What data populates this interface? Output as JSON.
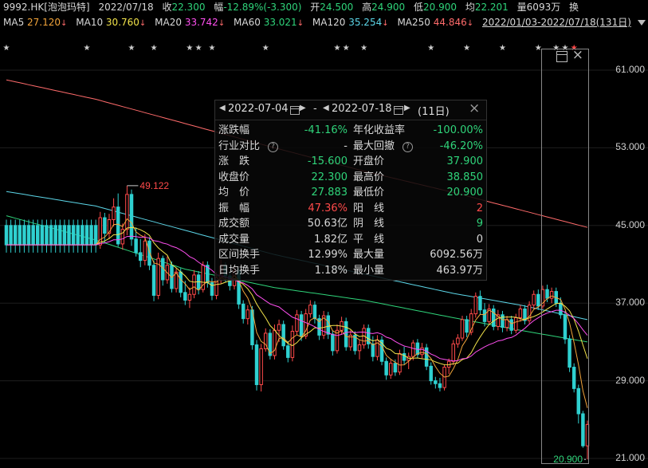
{
  "header": {
    "symbol": "9992.HK[泡泡玛特]",
    "date": "2022/07/18",
    "close_label": "收",
    "close_value": "22.300",
    "change_label": "幅",
    "change_value": "-12.89%(-3.300)",
    "open_label": "开",
    "open_value": "24.500",
    "high_label": "高",
    "high_value": "24.900",
    "low_label": "低",
    "low_value": "20.900",
    "avg_label": "均",
    "avg_value": "22.201",
    "volume_label": "量",
    "volume_value": "6093万",
    "turnover_label": "换"
  },
  "ma_bar": {
    "items": [
      {
        "label": "MA5",
        "value": "27.120",
        "color": "#f2a43a"
      },
      {
        "label": "MA10",
        "value": "30.760",
        "color": "#f2e34a"
      },
      {
        "label": "MA20",
        "value": "33.742",
        "color": "#ff4ff0"
      },
      {
        "label": "MA60",
        "value": "33.021",
        "color": "#2fd47a"
      },
      {
        "label": "MA120",
        "value": "35.254",
        "color": "#5cd6e8"
      },
      {
        "label": "MA250",
        "value": "44.846",
        "color": "#ff6b6b"
      }
    ],
    "arrow": "↓",
    "range": "2022/01/03-2022/07/18(131日)"
  },
  "panel": {
    "start_date": "2022-07-04",
    "sep": "-",
    "end_date": "2022-07-18",
    "days": "(11日)",
    "close_x": "×",
    "rows": [
      {
        "l1": "涨跌幅",
        "v1": "-41.16%",
        "c1": "#2fd47a",
        "l2": "年化收益率",
        "v2": "-100.00%",
        "c2": "#2fd47a"
      },
      {
        "l1": "行业对比",
        "v1": "-",
        "c1": "#d8d8d8",
        "l2": "最大回撤",
        "v2": "-46.20%",
        "c2": "#2fd47a"
      },
      {
        "l1": "涨　跌",
        "v1": "-15.600",
        "c1": "#2fd47a",
        "l2": "开盘价",
        "v2": "37.900",
        "c2": "#2fd47a"
      },
      {
        "l1": "收盘价",
        "v1": "22.300",
        "c1": "#2fd47a",
        "l2": "最高价",
        "v2": "38.850",
        "c2": "#2fd47a"
      },
      {
        "l1": "均　价",
        "v1": "27.883",
        "c1": "#2fd47a",
        "l2": "最低价",
        "v2": "20.900",
        "c2": "#2fd47a"
      },
      {
        "l1": "振　幅",
        "v1": "47.36%",
        "c1": "#ff4a4a",
        "l2": "阳　线",
        "v2": "2",
        "c2": "#ff4a4a"
      },
      {
        "l1": "成交额",
        "v1": "50.63亿",
        "c1": "#d8d8d8",
        "l2": "阴　线",
        "v2": "9",
        "c2": "#2fd47a"
      },
      {
        "l1": "成交量",
        "v1": "1.82亿",
        "c1": "#d8d8d8",
        "l2": "平　线",
        "v2": "0",
        "c2": "#d8d8d8"
      },
      {
        "l1": "区间换手",
        "v1": "12.99%",
        "c1": "#d8d8d8",
        "l2": "最大量",
        "v2": "6092.56万",
        "c2": "#d8d8d8"
      },
      {
        "l1": "日均换手",
        "v1": "1.18%",
        "c1": "#d8d8d8",
        "l2": "最小量",
        "v2": "463.97万",
        "c2": "#d8d8d8"
      }
    ]
  },
  "chart_data": {
    "type": "candlestick",
    "y_ticks": [
      "61.000",
      "53.000",
      "45.000",
      "37.000",
      "29.000",
      "21.000"
    ],
    "ylim": [
      21.0,
      61.0
    ],
    "annotations": {
      "high_label": "49.122",
      "low_label": "20.900"
    },
    "up_color": "#ff4a4a",
    "down_color": "#2fd0d0",
    "n": 131,
    "candles": [
      [
        45.0,
        45.6,
        42.2,
        43.0
      ],
      [
        43.0,
        46.4,
        42.6,
        45.8
      ],
      [
        45.8,
        46.3,
        43.2,
        44.2
      ],
      [
        44.2,
        46.2,
        43.6,
        45.6
      ],
      [
        45.6,
        47.8,
        44.9,
        46.9
      ],
      [
        46.9,
        48.3,
        42.8,
        43.1
      ],
      [
        43.1,
        45.2,
        42.5,
        44.6
      ],
      [
        44.6,
        49.1,
        44.0,
        48.2
      ],
      [
        48.2,
        48.7,
        42.9,
        43.6
      ],
      [
        43.6,
        44.8,
        41.8,
        42.2
      ],
      [
        42.2,
        43.6,
        40.7,
        41.4
      ],
      [
        41.4,
        44.1,
        40.9,
        43.4
      ],
      [
        43.4,
        43.8,
        40.4,
        40.9
      ],
      [
        40.9,
        41.4,
        37.2,
        37.8
      ],
      [
        37.8,
        42.2,
        37.4,
        41.6
      ],
      [
        41.6,
        41.9,
        38.8,
        39.4
      ],
      [
        39.4,
        41.8,
        39.0,
        40.9
      ],
      [
        40.9,
        41.3,
        38.1,
        38.5
      ],
      [
        38.5,
        40.6,
        38.1,
        40.2
      ],
      [
        40.2,
        40.6,
        37.6,
        38.1
      ],
      [
        38.1,
        39.3,
        36.8,
        37.3
      ],
      [
        37.3,
        38.6,
        36.5,
        37.9
      ],
      [
        37.9,
        40.4,
        37.5,
        39.9
      ],
      [
        39.9,
        40.3,
        37.9,
        38.4
      ],
      [
        38.4,
        41.3,
        38.1,
        40.9
      ],
      [
        40.9,
        41.3,
        38.6,
        39.1
      ],
      [
        39.1,
        39.6,
        37.3,
        37.8
      ],
      [
        37.8,
        40.2,
        37.4,
        39.6
      ],
      [
        39.6,
        41.5,
        39.0,
        40.8
      ],
      [
        40.8,
        41.2,
        39.2,
        39.8
      ],
      [
        39.8,
        40.2,
        38.3,
        38.8
      ],
      [
        38.8,
        40.7,
        38.4,
        40.3
      ],
      [
        40.3,
        40.6,
        36.4,
        36.9
      ],
      [
        36.9,
        37.3,
        34.9,
        35.4
      ],
      [
        35.4,
        36.8,
        34.8,
        36.3
      ],
      [
        36.3,
        36.7,
        32.2,
        32.7
      ],
      [
        32.7,
        33.2,
        28.0,
        28.6
      ],
      [
        28.6,
        32.8,
        27.9,
        32.3
      ],
      [
        32.3,
        34.4,
        32.0,
        33.9
      ],
      [
        33.9,
        34.3,
        31.2,
        31.6
      ],
      [
        31.6,
        34.8,
        31.2,
        34.2
      ],
      [
        34.2,
        35.3,
        33.0,
        34.8
      ],
      [
        34.8,
        35.2,
        32.2,
        32.6
      ],
      [
        32.6,
        33.1,
        30.9,
        31.4
      ],
      [
        31.4,
        34.7,
        31.0,
        34.1
      ],
      [
        34.1,
        36.3,
        33.7,
        35.8
      ],
      [
        35.8,
        36.2,
        33.1,
        33.6
      ],
      [
        33.6,
        36.4,
        33.3,
        35.9
      ],
      [
        35.9,
        37.3,
        35.5,
        36.8
      ],
      [
        36.8,
        37.2,
        34.9,
        35.4
      ],
      [
        35.4,
        35.8,
        33.2,
        33.7
      ],
      [
        33.7,
        36.2,
        33.3,
        35.7
      ],
      [
        35.7,
        36.1,
        33.3,
        33.8
      ],
      [
        33.8,
        34.2,
        31.6,
        32.1
      ],
      [
        32.1,
        34.8,
        31.8,
        34.2
      ],
      [
        34.2,
        35.6,
        33.8,
        35.1
      ],
      [
        35.1,
        35.5,
        32.1,
        32.5
      ],
      [
        32.5,
        34.2,
        32.1,
        33.7
      ],
      [
        33.7,
        34.1,
        31.7,
        32.1
      ],
      [
        32.1,
        33.2,
        31.2,
        32.7
      ],
      [
        32.7,
        34.8,
        32.3,
        34.4
      ],
      [
        34.4,
        34.8,
        32.3,
        32.8
      ],
      [
        32.8,
        33.6,
        31.0,
        31.5
      ],
      [
        31.5,
        33.7,
        31.1,
        33.2
      ],
      [
        33.2,
        33.6,
        30.6,
        31.0
      ],
      [
        31.0,
        31.4,
        29.1,
        29.6
      ],
      [
        29.6,
        31.2,
        29.2,
        30.8
      ],
      [
        30.8,
        31.2,
        29.5,
        29.9
      ],
      [
        29.9,
        32.2,
        29.6,
        31.8
      ],
      [
        31.8,
        32.5,
        30.7,
        31.1
      ],
      [
        31.1,
        31.9,
        30.2,
        31.5
      ],
      [
        31.5,
        33.2,
        31.1,
        32.9
      ],
      [
        32.9,
        33.3,
        31.3,
        31.7
      ],
      [
        31.7,
        32.9,
        31.3,
        32.4
      ],
      [
        32.4,
        32.8,
        30.1,
        30.5
      ],
      [
        30.5,
        30.9,
        28.6,
        29.0
      ],
      [
        29.0,
        29.4,
        28.2,
        28.7
      ],
      [
        28.7,
        29.3,
        27.9,
        28.3
      ],
      [
        28.3,
        30.7,
        28.0,
        30.4
      ],
      [
        30.4,
        31.3,
        29.7,
        31.0
      ],
      [
        31.0,
        33.2,
        30.6,
        32.8
      ],
      [
        32.8,
        33.8,
        32.4,
        33.4
      ],
      [
        33.4,
        35.7,
        33.1,
        35.3
      ],
      [
        35.3,
        35.7,
        33.5,
        34.0
      ],
      [
        34.0,
        36.4,
        33.7,
        35.9
      ],
      [
        35.9,
        38.1,
        35.5,
        37.7
      ],
      [
        37.7,
        38.3,
        35.8,
        36.3
      ],
      [
        36.3,
        37.0,
        34.6,
        35.1
      ],
      [
        35.1,
        36.9,
        34.8,
        36.4
      ],
      [
        36.4,
        36.8,
        34.2,
        34.6
      ],
      [
        34.6,
        36.3,
        34.2,
        35.8
      ],
      [
        35.8,
        36.2,
        34.0,
        34.5
      ],
      [
        34.5,
        35.7,
        34.1,
        35.3
      ],
      [
        35.3,
        35.7,
        33.8,
        34.2
      ],
      [
        34.2,
        35.9,
        33.9,
        35.5
      ],
      [
        35.5,
        36.8,
        35.1,
        36.4
      ],
      [
        36.4,
        36.8,
        34.8,
        35.2
      ],
      [
        35.2,
        37.2,
        34.9,
        36.8
      ],
      [
        36.8,
        38.3,
        36.4,
        37.9
      ],
      [
        37.9,
        38.4,
        36.3,
        36.7
      ],
      [
        36.7,
        38.8,
        36.4,
        38.4
      ],
      [
        38.4,
        38.9,
        37.1,
        37.5
      ],
      [
        37.5,
        38.6,
        37.0,
        38.2
      ],
      [
        38.2,
        38.6,
        36.6,
        37.0
      ],
      [
        37.0,
        37.6,
        35.4,
        35.8
      ],
      [
        35.8,
        36.2,
        32.8,
        33.3
      ],
      [
        33.3,
        33.7,
        29.9,
        30.4
      ],
      [
        30.4,
        30.8,
        27.8,
        28.2
      ],
      [
        28.2,
        28.6,
        24.6,
        25.6
      ],
      [
        25.6,
        25.9,
        22.1,
        22.3
      ],
      [
        22.3,
        24.9,
        20.9,
        24.5
      ]
    ],
    "ma_series": [
      {
        "name": "MA5",
        "color": "#f2a43a"
      },
      {
        "name": "MA10",
        "color": "#f2e34a"
      },
      {
        "name": "MA20",
        "color": "#ff4ff0"
      },
      {
        "name": "MA60",
        "color": "#2fd47a"
      },
      {
        "name": "MA120",
        "color": "#5cd6e8"
      },
      {
        "name": "MA250",
        "color": "#ff6b6b"
      }
    ],
    "long_ma_anchors": {
      "MA60": [
        [
          0,
          46.0
        ],
        [
          20,
          43.5
        ],
        [
          40,
          40.5
        ],
        [
          60,
          38.6
        ],
        [
          80,
          37.3
        ],
        [
          100,
          35.5
        ],
        [
          115,
          34.2
        ],
        [
          130,
          33.0
        ]
      ],
      "MA120": [
        [
          0,
          48.5
        ],
        [
          20,
          47.0
        ],
        [
          40,
          44.5
        ],
        [
          60,
          42.0
        ],
        [
          80,
          40.0
        ],
        [
          100,
          38.0
        ],
        [
          115,
          36.8
        ],
        [
          130,
          35.3
        ]
      ],
      "MA250": [
        [
          0,
          60.0
        ],
        [
          20,
          58.0
        ],
        [
          40,
          55.5
        ],
        [
          60,
          53.0
        ],
        [
          80,
          50.6
        ],
        [
          100,
          48.4
        ],
        [
          115,
          46.6
        ],
        [
          130,
          44.8
        ]
      ]
    },
    "star_positions": [
      0,
      18,
      28,
      33,
      41,
      43,
      46,
      58,
      74,
      76,
      80,
      95,
      103,
      111,
      119,
      123,
      125
    ]
  }
}
